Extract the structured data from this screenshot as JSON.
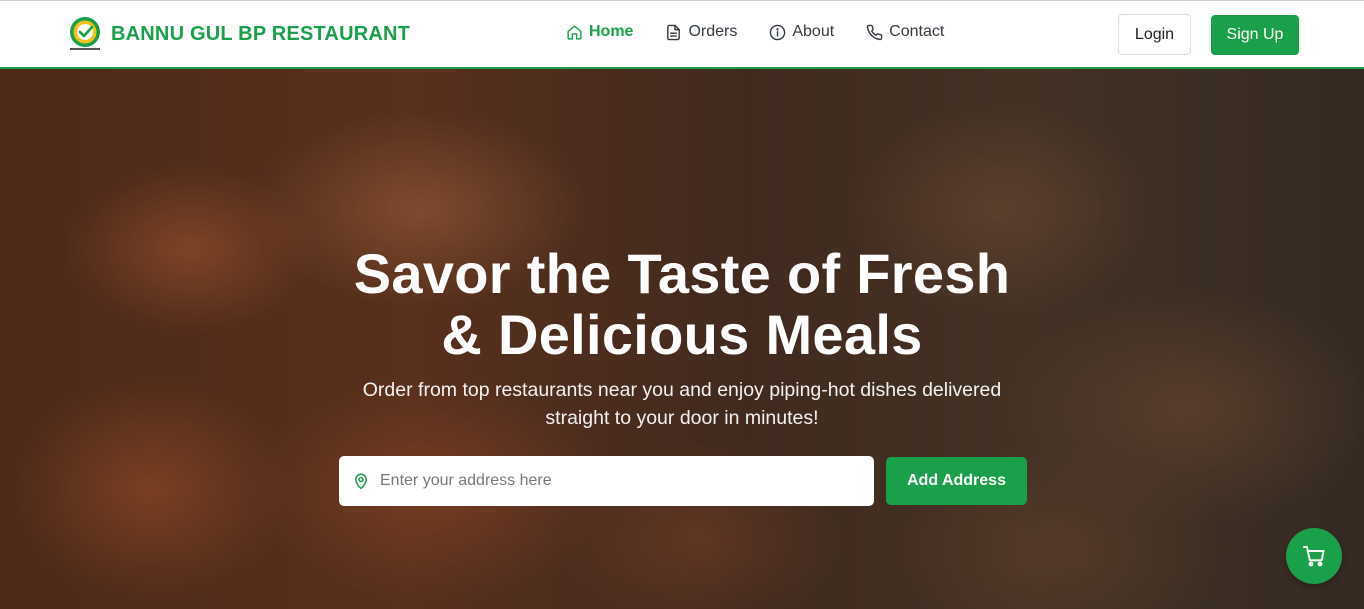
{
  "colors": {
    "brand": "#1aa04a",
    "nav_text": "#333a40"
  },
  "header": {
    "brand_name": "BANNU GUL BP RESTAURANT",
    "logo_icon": "restaurant-logo-icon",
    "nav": [
      {
        "label": "Home",
        "icon": "home-icon",
        "active": true
      },
      {
        "label": "Orders",
        "icon": "document-icon",
        "active": false
      },
      {
        "label": "About",
        "icon": "info-icon",
        "active": false
      },
      {
        "label": "Contact",
        "icon": "phone-icon",
        "active": false
      }
    ],
    "login_label": "Login",
    "signup_label": "Sign Up"
  },
  "hero": {
    "title_line1": "Savor the Taste of Fresh",
    "title_line2": "& Delicious Meals",
    "subtitle_line1": "Order from top restaurants near you and enjoy piping-hot dishes delivered",
    "subtitle_line2": "straight to your door in minutes!",
    "address_placeholder": "Enter your address here",
    "address_icon": "location-pin-icon",
    "add_address_label": "Add Address"
  },
  "cart": {
    "icon": "cart-icon"
  }
}
